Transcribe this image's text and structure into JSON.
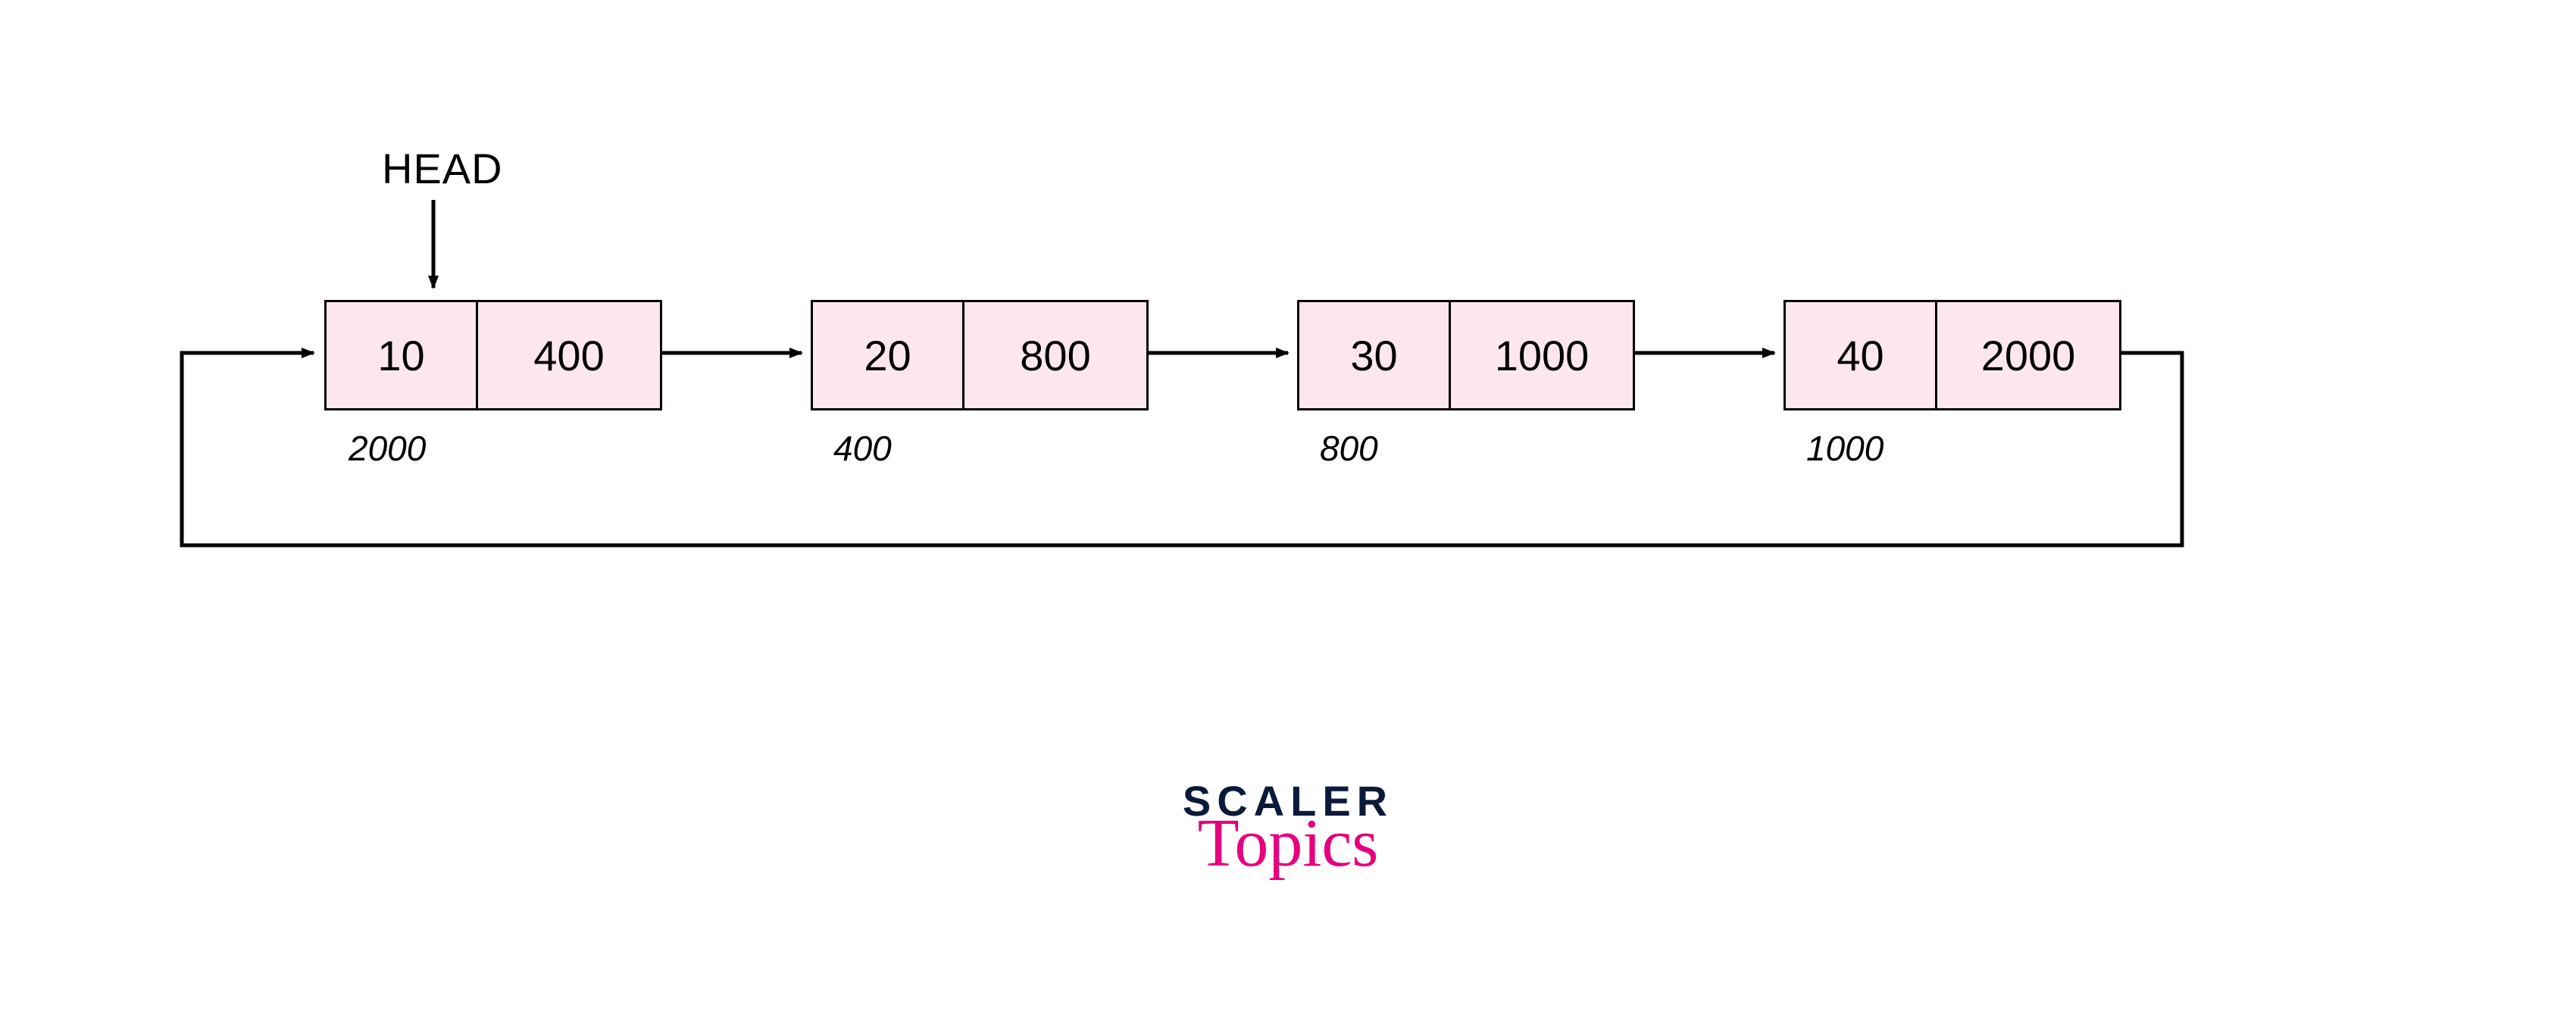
{
  "head_label": "HEAD",
  "nodes": [
    {
      "data": "10",
      "pointer": "400",
      "address": "2000"
    },
    {
      "data": "20",
      "pointer": "800",
      "address": "400"
    },
    {
      "data": "30",
      "pointer": "1000",
      "address": "800"
    },
    {
      "data": "40",
      "pointer": "2000",
      "address": "1000"
    }
  ],
  "logo": {
    "line1": "SCALER",
    "line2": "Topics"
  }
}
